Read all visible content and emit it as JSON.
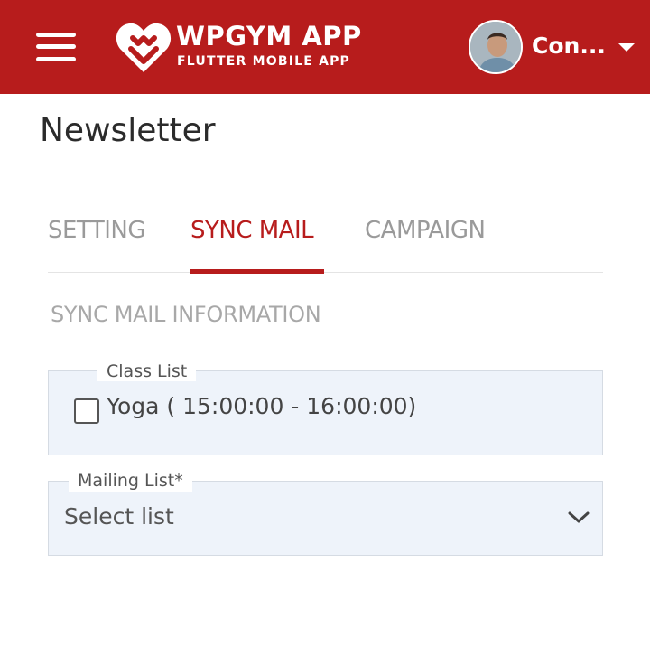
{
  "header": {
    "brand_title": "WPGYM APP",
    "brand_subtitle": "FLUTTER MOBILE APP",
    "user_name": "Con...",
    "background_color": "#b71c1c",
    "menu_icon": "hamburger-menu-icon",
    "logo_icon": "heart-gym-logo-icon",
    "dropdown_icon": "caret-down-icon"
  },
  "page": {
    "title": "Newsletter"
  },
  "tabs": [
    {
      "label": "SETTING",
      "active": false
    },
    {
      "label": "SYNC MAIL",
      "active": true
    },
    {
      "label": "CAMPAIGN",
      "active": false
    }
  ],
  "section": {
    "title": "SYNC MAIL INFORMATION"
  },
  "class_list": {
    "label": "Class List",
    "items": [
      {
        "label": "Yoga ( 15:00:00 - 16:00:00)",
        "checked": false
      }
    ]
  },
  "mailing_list": {
    "label": "Mailing List*",
    "placeholder": "Select list",
    "dropdown_icon": "chevron-down-icon"
  },
  "colors": {
    "accent": "#b71c1c",
    "field_background": "#eef3fa",
    "inactive_tab": "#9a9a9a"
  }
}
